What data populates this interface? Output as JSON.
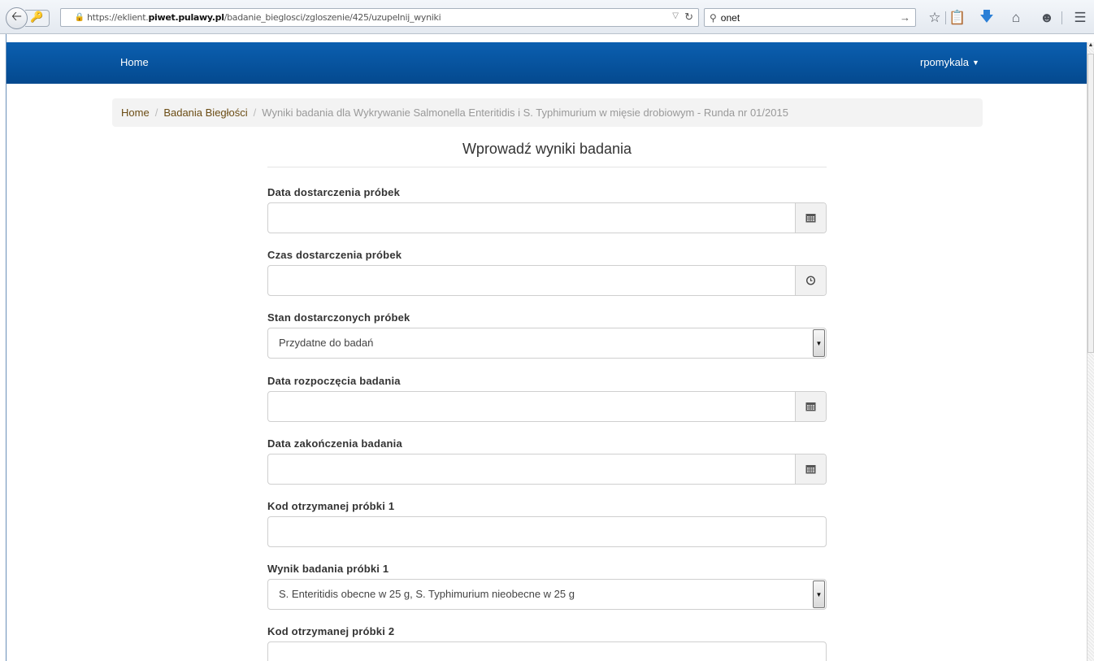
{
  "browser": {
    "url_prefix": "https://eklient.",
    "url_domain": "piwet.pulawy.pl",
    "url_path": "/badanie_bieglosci/zgloszenie/425/uzupelnij_wyniki",
    "search_value": "onet"
  },
  "navbar": {
    "home_label": "Home",
    "user_label": "rpomykala"
  },
  "breadcrumb": {
    "items": [
      "Home",
      "Badania Biegłości"
    ],
    "active": "Wyniki badania dla Wykrywanie Salmonella Enteritidis i S. Typhimurium w mięsie drobiowym - Runda nr 01/2015",
    "separator": "/"
  },
  "form": {
    "title": "Wprowadź wyniki badania",
    "fields": [
      {
        "label": "Data dostarczenia próbek",
        "value": "",
        "addon": "calendar-icon"
      },
      {
        "label": "Czas dostarczenia próbek",
        "value": "",
        "addon": "clock-icon"
      },
      {
        "label": "Stan dostarczonych próbek",
        "selected": "Przydatne do badań"
      },
      {
        "label": "Data rozpoczęcia badania",
        "value": "",
        "addon": "calendar-icon"
      },
      {
        "label": "Data zakończenia badania",
        "value": "",
        "addon": "calendar-icon"
      },
      {
        "label": "Kod otrzymanej próbki 1",
        "value": ""
      },
      {
        "label": "Wynik badania próbki 1",
        "selected": "S. Enteritidis obecne w 25 g, S. Typhimurium nieobecne w 25 g"
      },
      {
        "label": "Kod otrzymanej próbki 2",
        "value": ""
      }
    ]
  },
  "colors": {
    "navbar": "#04498e",
    "breadcrumb_link": "#6b4c14"
  }
}
